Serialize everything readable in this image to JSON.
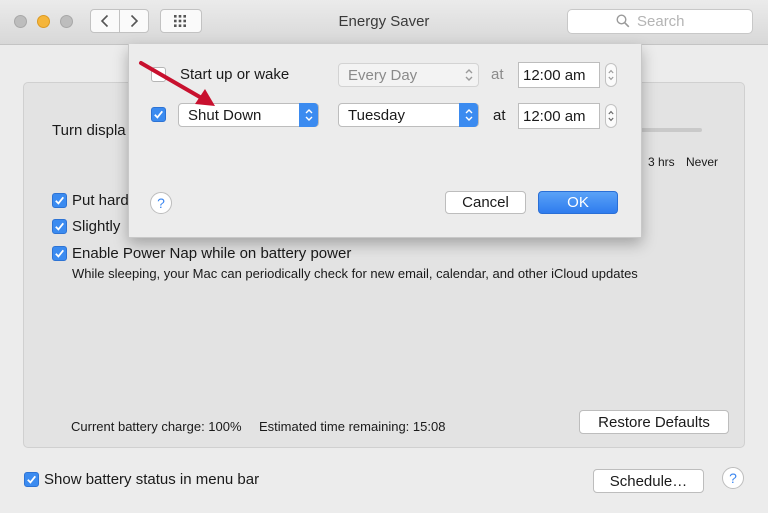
{
  "window": {
    "title": "Energy Saver"
  },
  "search": {
    "placeholder": "Search"
  },
  "panel": {
    "turn_display_label": "Turn displa",
    "slider_ticks": [
      "3 hrs",
      "Never"
    ],
    "options": [
      {
        "label": "Put hard",
        "checked": true
      },
      {
        "label": "Slightly",
        "checked": true
      },
      {
        "label": "Enable Power Nap while on battery power",
        "checked": true
      }
    ],
    "power_nap_description": "While sleeping, your Mac can periodically check for new email, calendar, and other iCloud updates",
    "battery_charge": "Current battery charge: 100%",
    "time_remaining": "Estimated time remaining: 15:08",
    "restore_defaults": "Restore Defaults"
  },
  "footer": {
    "show_battery_status": {
      "label": "Show battery status in menu bar",
      "checked": true
    },
    "schedule_button": "Schedule…",
    "help": "?"
  },
  "sheet": {
    "row1": {
      "checked": false,
      "label": "Start up or wake",
      "day": "Every Day",
      "at": "at",
      "time": "12:00 am",
      "enabled": false
    },
    "row2": {
      "checked": true,
      "action": "Shut Down",
      "day": "Tuesday",
      "at": "at",
      "time": "12:00 am",
      "enabled": true
    },
    "help": "?",
    "cancel": "Cancel",
    "ok": "OK"
  },
  "annotation": {
    "color": "#c8102e",
    "icon": "red-arrow"
  },
  "colors": {
    "accent": "#3b8bf0",
    "minimize": "#f5b53a"
  }
}
